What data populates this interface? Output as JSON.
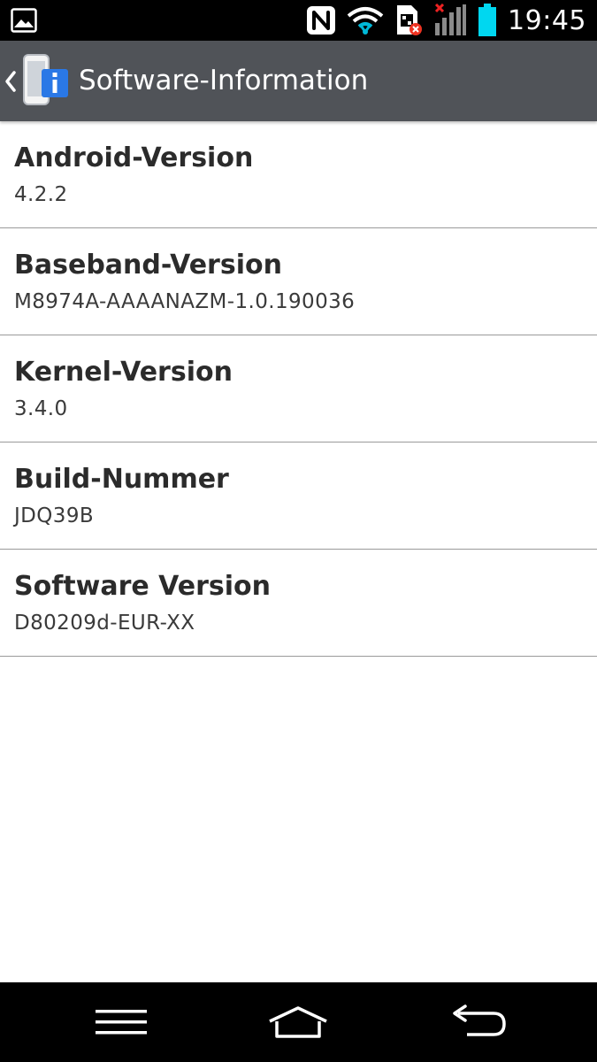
{
  "status_bar": {
    "time": "19:45",
    "icons": [
      "gallery-notification-icon",
      "nfc-icon",
      "wifi-icon",
      "sim-card-error-icon",
      "signal-no-service-icon",
      "battery-icon"
    ],
    "battery_color": "#00d7f0"
  },
  "action_bar": {
    "title": "Software-Information",
    "background": "#505358"
  },
  "items": [
    {
      "title": "Android-Version",
      "value": "4.2.2"
    },
    {
      "title": "Baseband-Version",
      "value": "M8974A-AAAANAZM-1.0.190036"
    },
    {
      "title": "Kernel-Version",
      "value": "3.4.0"
    },
    {
      "title": "Build-Nummer",
      "value": "JDQ39B"
    },
    {
      "title": "Software Version",
      "value": "D80209d-EUR-XX"
    }
  ],
  "nav_bar": {
    "icons": [
      "menu-icon",
      "home-icon",
      "back-icon"
    ]
  }
}
